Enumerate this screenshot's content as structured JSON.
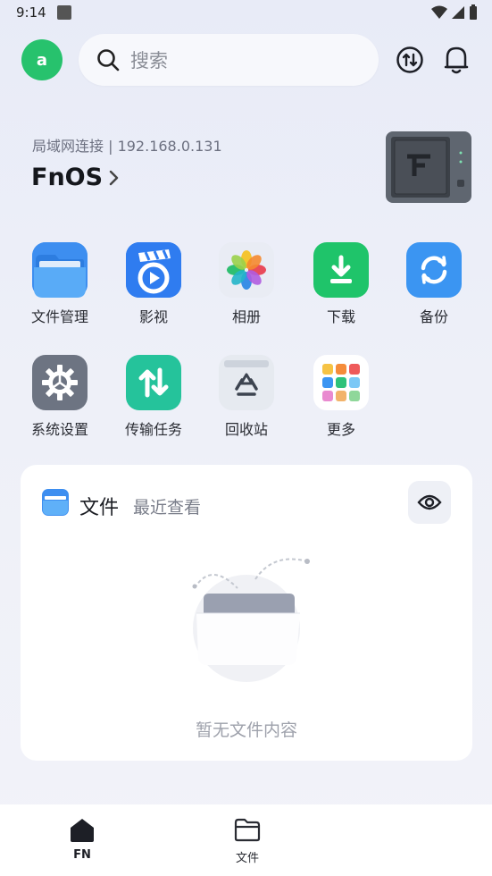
{
  "status_bar": {
    "time": "9:14"
  },
  "header": {
    "avatar_letter": "a",
    "search_placeholder": "搜索"
  },
  "device": {
    "connection_label": "局域网连接 | 192.168.0.131",
    "name": "FnOS"
  },
  "apps": [
    {
      "label": "文件管理",
      "icon": "folder-icon"
    },
    {
      "label": "影视",
      "icon": "film-icon"
    },
    {
      "label": "相册",
      "icon": "photos-icon"
    },
    {
      "label": "下载",
      "icon": "download-icon"
    },
    {
      "label": "备份",
      "icon": "backup-icon"
    },
    {
      "label": "系统设置",
      "icon": "settings-icon"
    },
    {
      "label": "传输任务",
      "icon": "transfer-icon"
    },
    {
      "label": "回收站",
      "icon": "recycle-icon"
    },
    {
      "label": "更多",
      "icon": "more-icon"
    }
  ],
  "files_card": {
    "title": "文件",
    "subtitle": "最近查看",
    "empty_text": "暂无文件内容"
  },
  "tabbar": {
    "tabs": [
      {
        "label": "FN",
        "active": true
      },
      {
        "label": "文件",
        "active": false
      }
    ]
  },
  "colors": {
    "accent_green": "#27c26d",
    "blue": "#3d8ef0",
    "text_primary": "#15171c",
    "text_secondary": "#6c7080"
  }
}
